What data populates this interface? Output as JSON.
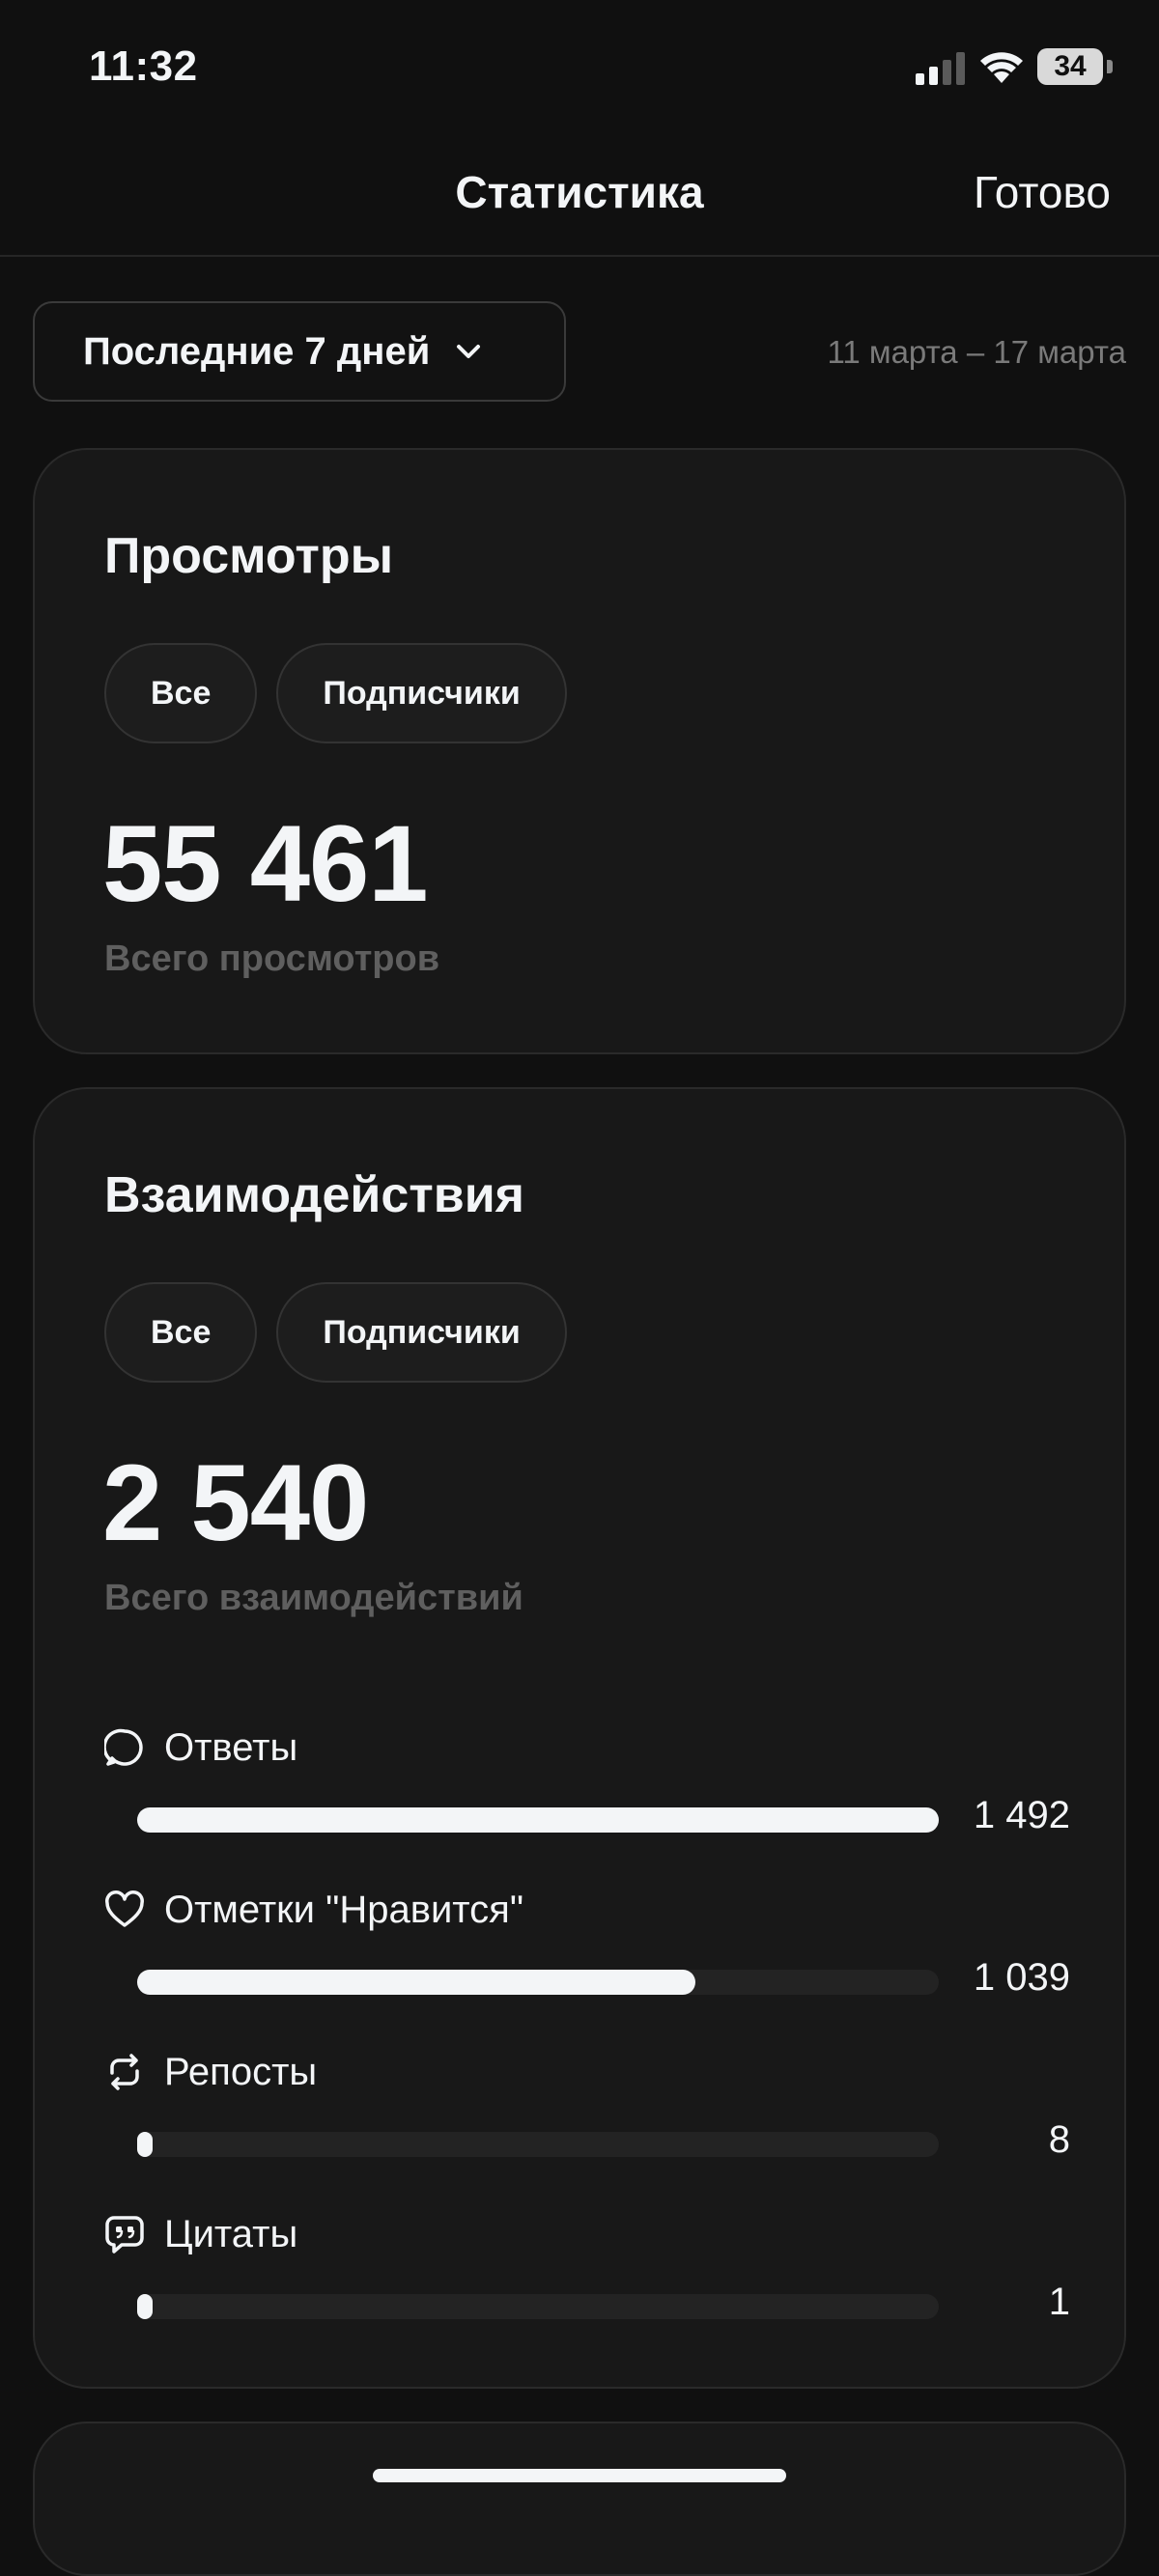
{
  "status": {
    "time": "11:32",
    "battery": "34"
  },
  "header": {
    "title": "Статистика",
    "done_label": "Готово"
  },
  "range": {
    "selected": "Последние 7 дней",
    "dates": "11 марта – 17 марта"
  },
  "views": {
    "title": "Просмотры",
    "chips": [
      "Все",
      "Подписчики"
    ],
    "total": "55 461",
    "caption": "Всего просмотров"
  },
  "interactions": {
    "title": "Взаимодействия",
    "chips": [
      "Все",
      "Подписчики"
    ],
    "total": "2 540",
    "caption": "Всего взаимодействий",
    "metrics": [
      {
        "label": "Ответы",
        "value": "1 492",
        "fraction": 1.0,
        "icon": "reply-icon"
      },
      {
        "label": "Отметки \"Нравится\"",
        "value": "1 039",
        "fraction": 0.696,
        "icon": "heart-icon"
      },
      {
        "label": "Репосты",
        "value": "8",
        "fraction": 0.005,
        "icon": "repost-icon"
      },
      {
        "label": "Цитаты",
        "value": "1",
        "fraction": 0.001,
        "icon": "quote-icon"
      }
    ]
  }
}
